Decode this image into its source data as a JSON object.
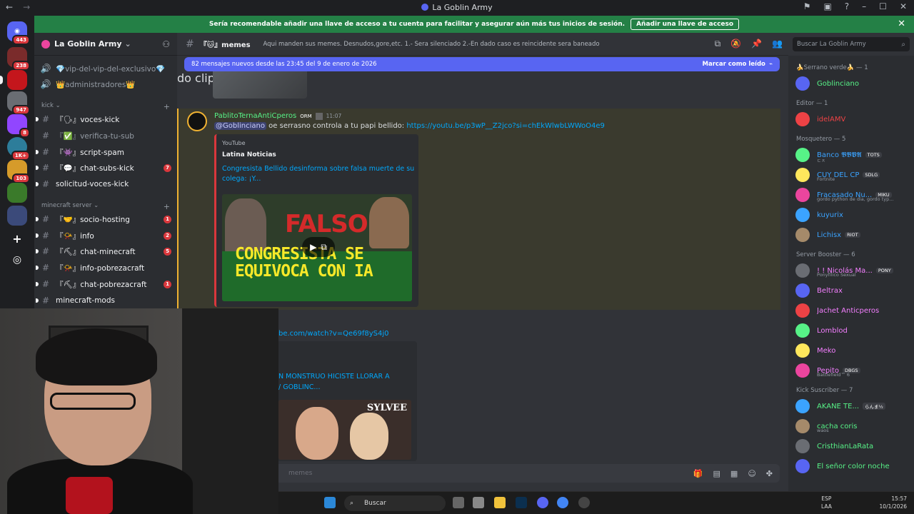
{
  "titlebar": {
    "title": "La Goblin Army",
    "back": "←",
    "forward": "→"
  },
  "banner": {
    "text": "Sería recomendable añadir una llave de acceso a tu cuenta para facilitar y asegurar aún más tus inicios de sesión.",
    "button": "Añadir una llave de acceso",
    "close": "✕"
  },
  "rail": {
    "badges": [
      "443",
      "238",
      "947",
      "8",
      "1K+",
      "103"
    ]
  },
  "guild": {
    "name": "La Goblin Army",
    "chevron": "⌄"
  },
  "channels": {
    "top": [
      {
        "label": "💎vip-del-vip-del-exclusivo💎"
      },
      {
        "label": "👑administradores👑"
      }
    ],
    "cat_kick": "kick ⌄",
    "kick": [
      {
        "label": "『🗣』voces-kick"
      },
      {
        "label": "『✅』verifica-tu-sub"
      },
      {
        "label": "『👾』script-spam"
      },
      {
        "label": "『💬』chat-subs-kick",
        "badge": "7"
      },
      {
        "label": "solicitud-voces-kick"
      }
    ],
    "cat_mc": "minecraft server ⌄",
    "mc": [
      {
        "label": "『🤝』socio-hosting",
        "badge": "1"
      },
      {
        "label": "『📯』info",
        "badge": "2"
      },
      {
        "label": "『⛏』chat-minecraft",
        "badge": "5"
      },
      {
        "label": "『📯』info-pobrezacraft"
      },
      {
        "label": "『⛏』chat-pobrezacraft",
        "badge": "1"
      },
      {
        "label": "minecraft-mods"
      }
    ]
  },
  "chat": {
    "channel": "『🐱』memes",
    "topic": "Aqui manden sus memes. Desnudos,gore,etc. 1.- Sera silenciado 2.-En dado caso es reincidente sera baneado",
    "newbar": "82 mensajes nuevos desde las 23:45 del 9 de enero de 2026",
    "mark_read": "Marcar como leído",
    "search_placeholder": "Buscar La Goblin Army",
    "composer_placeholder": "Enviar mensaje a #『🐱』memes",
    "composer_visible": "memes"
  },
  "message": {
    "author": "PablitoTernaAntiCperos",
    "tag": "ORM",
    "time": "11:07",
    "mention": "@Goblinciano",
    "text": " oe serrasno controla a tu papi bellido: ",
    "url": "https://youtube.com/p3wP__Z2jco?si=chEkWlwbLWWoO4e9",
    "url_visible": "https://youtu.be/p3wP__Z2jco?si=chEkWlwbLWWoO4e9",
    "embed_provider": "YouTube",
    "embed_author": "Latina Noticias",
    "embed_title": "Congresista Bellido desinforma sobre falsa muerte de su colega: ¡Y...",
    "thumb_line1": "CONGRESISTA SE",
    "thumb_line2": "EQUIVOCA CON IA",
    "thumb_falso": "FALSO"
  },
  "message2": {
    "url": "be.com/watch?v=Qe69f8yS4j0",
    "provider": "do clips",
    "title_line1": "N MONSTRUO HICISTE LLORAR A",
    "title_line2": "/ GOBLINC...",
    "thumb_text": "SYLVEE"
  },
  "members": [
    {
      "cat": "🍌Serrano verde🍌 — 1"
    },
    {
      "name": "Goblinciano",
      "color": "#57f287"
    },
    {
      "cat": "Editor — 1"
    },
    {
      "name": "idelAMV",
      "color": "#ed4245"
    },
    {
      "cat": "Mosquetero — 5"
    },
    {
      "name": "Banco 𝕭𝕭𝖁𝕬",
      "color": "#3ba3ff",
      "tag": "TOTS",
      "sub": "ㄷㅈ"
    },
    {
      "name": "CUY DEL CP",
      "color": "#3ba3ff",
      "tag": "SDLG",
      "sub": "Fortnite"
    },
    {
      "name": "Fracasado Nu...",
      "color": "#3ba3ff",
      "tag": "MIKU",
      "sub": "gordo python de dia, gordo typ..."
    },
    {
      "name": "kuyurix",
      "color": "#3ba3ff"
    },
    {
      "name": "Lichisx",
      "color": "#3ba3ff",
      "tag": "RIOT"
    },
    {
      "cat": "Server Booster — 6"
    },
    {
      "name": "! ! Nicolás Ma...",
      "color": "#f47fff",
      "tag": "PONY",
      "sub": "Ponyfílico Sexual"
    },
    {
      "name": "Beltrax",
      "color": "#f47fff"
    },
    {
      "name": "Jachet Anticperos",
      "color": "#f47fff"
    },
    {
      "name": "Lomblod",
      "color": "#f47fff"
    },
    {
      "name": "Meko",
      "color": "#f47fff"
    },
    {
      "name": "Pepito",
      "color": "#f47fff",
      "tag": "DBGS",
      "sub": "Battlefield™ 6"
    },
    {
      "cat": "Kick Suscriber — 7"
    },
    {
      "name": "AKANE TE...",
      "color": "#57f287",
      "tag": "らんま½"
    },
    {
      "name": "cacha coris",
      "color": "#57f287",
      "sub": "waos"
    },
    {
      "name": "CristhianLaRata",
      "color": "#57f287"
    },
    {
      "name": "El señor color noche",
      "color": "#57f287"
    }
  ],
  "taskbar": {
    "search": "Buscar",
    "lang": "ESP",
    "lang2": "LAA",
    "time": "15:57",
    "date": "10/1/2026"
  }
}
